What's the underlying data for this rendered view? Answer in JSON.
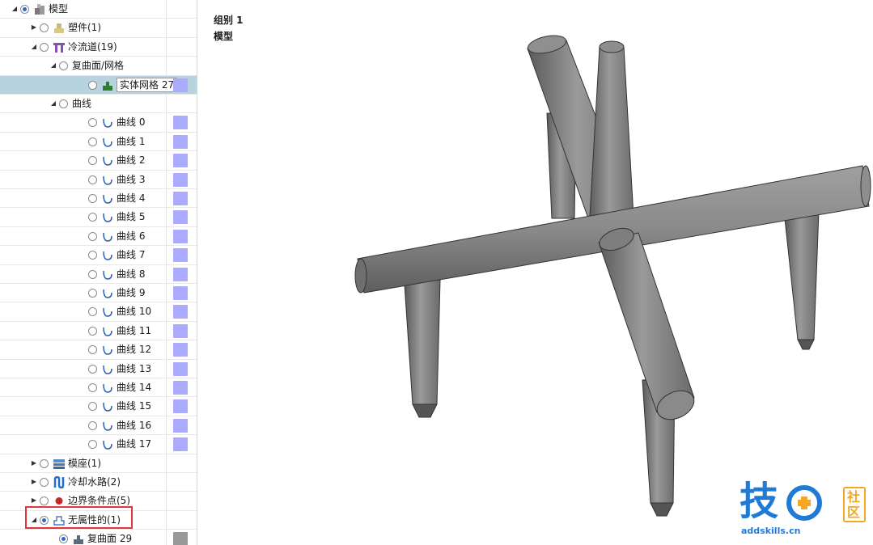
{
  "tree": {
    "rows": [
      {
        "label": "模型",
        "indent": 0,
        "arrow": "expanded",
        "radio": "on",
        "icon": "model-icon",
        "swatch": null
      },
      {
        "label": "塑件(1)",
        "indent": 1,
        "arrow": "collapsed",
        "radio": "off",
        "icon": "part-icon",
        "swatch": null
      },
      {
        "label": "冷流道(19)",
        "indent": 1,
        "arrow": "expanded",
        "radio": "off",
        "icon": "cold-runner-icon",
        "swatch": null
      },
      {
        "label": "复曲面/网格",
        "indent": 2,
        "arrow": "expanded",
        "radio": "off",
        "icon": null,
        "swatch": null
      },
      {
        "label": "实体网格 27",
        "indent": 3,
        "arrow": null,
        "radio": "off",
        "icon": "solid-mesh-icon",
        "swatch": "#aaaaff",
        "editing": true
      },
      {
        "label": "曲线",
        "indent": 2,
        "arrow": "expanded",
        "radio": "off",
        "icon": null,
        "swatch": null
      },
      {
        "label": "曲线 0",
        "indent": 3,
        "arrow": null,
        "radio": "off",
        "icon": "curve-icon",
        "swatch": "#aaaaff"
      },
      {
        "label": "曲线 1",
        "indent": 3,
        "arrow": null,
        "radio": "off",
        "icon": "curve-icon",
        "swatch": "#aaaaff"
      },
      {
        "label": "曲线 2",
        "indent": 3,
        "arrow": null,
        "radio": "off",
        "icon": "curve-icon",
        "swatch": "#aaaaff"
      },
      {
        "label": "曲线 3",
        "indent": 3,
        "arrow": null,
        "radio": "off",
        "icon": "curve-icon",
        "swatch": "#aaaaff"
      },
      {
        "label": "曲线 4",
        "indent": 3,
        "arrow": null,
        "radio": "off",
        "icon": "curve-icon",
        "swatch": "#aaaaff"
      },
      {
        "label": "曲线 5",
        "indent": 3,
        "arrow": null,
        "radio": "off",
        "icon": "curve-icon",
        "swatch": "#aaaaff"
      },
      {
        "label": "曲线 6",
        "indent": 3,
        "arrow": null,
        "radio": "off",
        "icon": "curve-icon",
        "swatch": "#aaaaff"
      },
      {
        "label": "曲线 7",
        "indent": 3,
        "arrow": null,
        "radio": "off",
        "icon": "curve-icon",
        "swatch": "#aaaaff"
      },
      {
        "label": "曲线 8",
        "indent": 3,
        "arrow": null,
        "radio": "off",
        "icon": "curve-icon",
        "swatch": "#aaaaff"
      },
      {
        "label": "曲线 9",
        "indent": 3,
        "arrow": null,
        "radio": "off",
        "icon": "curve-icon",
        "swatch": "#aaaaff"
      },
      {
        "label": "曲线 10",
        "indent": 3,
        "arrow": null,
        "radio": "off",
        "icon": "curve-icon",
        "swatch": "#aaaaff"
      },
      {
        "label": "曲线 11",
        "indent": 3,
        "arrow": null,
        "radio": "off",
        "icon": "curve-icon",
        "swatch": "#aaaaff"
      },
      {
        "label": "曲线 12",
        "indent": 3,
        "arrow": null,
        "radio": "off",
        "icon": "curve-icon",
        "swatch": "#aaaaff"
      },
      {
        "label": "曲线 13",
        "indent": 3,
        "arrow": null,
        "radio": "off",
        "icon": "curve-icon",
        "swatch": "#aaaaff"
      },
      {
        "label": "曲线 14",
        "indent": 3,
        "arrow": null,
        "radio": "off",
        "icon": "curve-icon",
        "swatch": "#aaaaff"
      },
      {
        "label": "曲线 15",
        "indent": 3,
        "arrow": null,
        "radio": "off",
        "icon": "curve-icon",
        "swatch": "#aaaaff"
      },
      {
        "label": "曲线 16",
        "indent": 3,
        "arrow": null,
        "radio": "off",
        "icon": "curve-icon",
        "swatch": "#aaaaff"
      },
      {
        "label": "曲线 17",
        "indent": 3,
        "arrow": null,
        "radio": "off",
        "icon": "curve-icon",
        "swatch": "#aaaaff"
      },
      {
        "label": "模座(1)",
        "indent": 1,
        "arrow": "collapsed",
        "radio": "off",
        "icon": "mold-base-icon",
        "swatch": null
      },
      {
        "label": "冷却水路(2)",
        "indent": 1,
        "arrow": "collapsed",
        "radio": "off",
        "icon": "cooling-channel-icon",
        "swatch": null
      },
      {
        "label": "边界条件点(5)",
        "indent": 1,
        "arrow": "collapsed",
        "radio": "off",
        "icon": "boundary-point-icon",
        "swatch": null
      },
      {
        "label": "无属性的(1)",
        "indent": 1,
        "arrow": "expanded",
        "radio": "on",
        "icon": "no-attribute-icon",
        "swatch": null
      },
      {
        "label": "复曲面 29",
        "indent": 2,
        "arrow": null,
        "radio": "on",
        "icon": "surface-icon",
        "swatch": "#999999"
      }
    ]
  },
  "viewport": {
    "group_label": "组别 1",
    "model_label": "模型"
  },
  "watermark": {
    "char": "技",
    "side_top": "社",
    "side_bottom": "区",
    "url": "addskills.cn",
    "color": "#1f7bd6",
    "accent": "#f5a623"
  },
  "colors": {
    "selected_row": "#b7d3df",
    "highlight_box": "#e0383a",
    "pipe": "#8a8a8a"
  }
}
